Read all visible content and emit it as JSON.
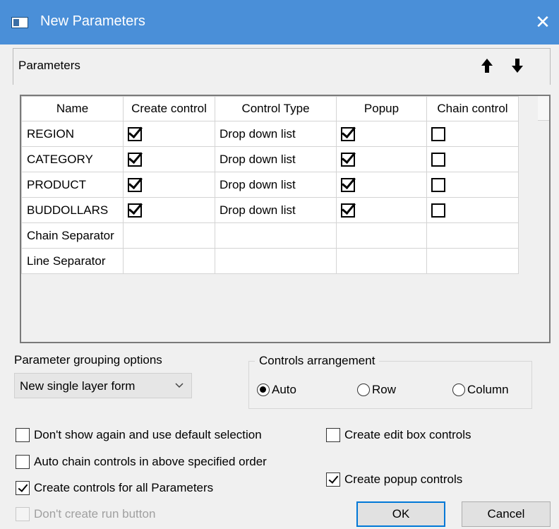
{
  "window": {
    "title": "New Parameters",
    "close_glyph": "✕"
  },
  "parameters_section": {
    "label": "Parameters",
    "move_up_icon": "arrow-up-icon",
    "move_down_icon": "arrow-down-icon"
  },
  "grid": {
    "columns": [
      "Name",
      "Create control",
      "Control Type",
      "Popup",
      "Chain control"
    ],
    "rows": [
      {
        "name": "REGION",
        "create_control": true,
        "control_type": "Drop down list",
        "popup": true,
        "chain_control": false
      },
      {
        "name": "CATEGORY",
        "create_control": true,
        "control_type": "Drop down list",
        "popup": true,
        "chain_control": false
      },
      {
        "name": "PRODUCT",
        "create_control": true,
        "control_type": "Drop down list",
        "popup": true,
        "chain_control": false
      },
      {
        "name": "BUDDOLLARS",
        "create_control": true,
        "control_type": "Drop down list",
        "popup": true,
        "chain_control": false
      },
      {
        "name": "Chain Separator"
      },
      {
        "name": "Line Separator"
      }
    ]
  },
  "grouping": {
    "label": "Parameter grouping options",
    "selected": "New single layer form"
  },
  "arrangement": {
    "legend": "Controls arrangement",
    "options": [
      "Auto",
      "Row",
      "Column"
    ],
    "selected": "Auto"
  },
  "options": {
    "dont_show_again": {
      "label": "Don't show again and use default selection",
      "checked": false
    },
    "auto_chain": {
      "label": "Auto chain controls in above specified order",
      "checked": false
    },
    "create_all": {
      "label": "Create controls for all Parameters",
      "checked": true
    },
    "dont_create_run": {
      "label": "Don't create run button",
      "checked": false,
      "disabled": true
    },
    "create_edit_box": {
      "label": "Create edit box controls",
      "checked": false
    },
    "create_popup": {
      "label": "Create popup controls",
      "checked": true
    }
  },
  "buttons": {
    "ok": "OK",
    "cancel": "Cancel"
  }
}
